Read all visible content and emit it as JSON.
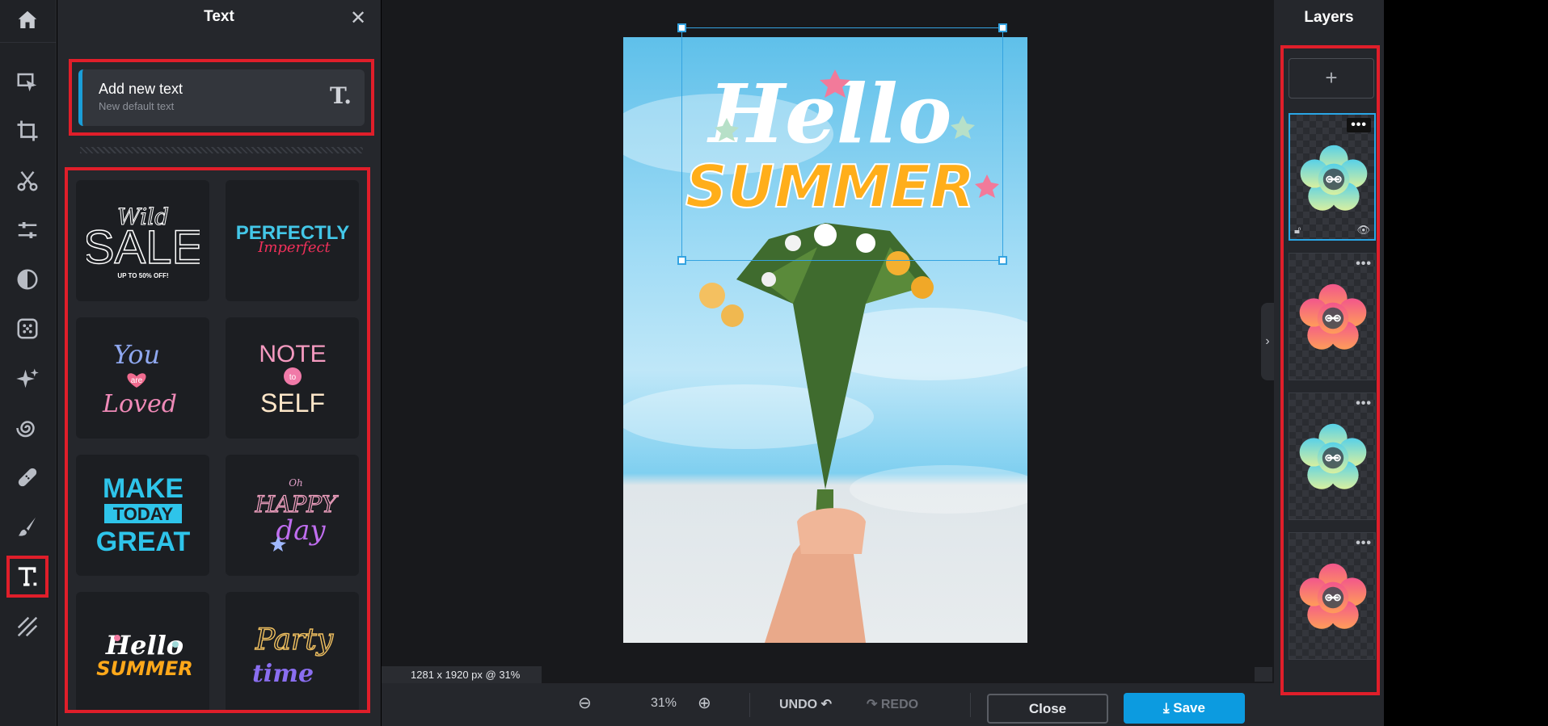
{
  "toolbar": {
    "tools": [
      "home-icon",
      "select-arrow-icon",
      "crop-icon",
      "scissors-icon",
      "adjust-sliders-icon",
      "contrast-icon",
      "effects-icon",
      "sparkle-icon",
      "swirl-icon",
      "bandage-icon",
      "brush-icon",
      "text-icon",
      "texture-icon"
    ],
    "active_tool": "text-icon"
  },
  "text_panel": {
    "title": "Text",
    "add_new_title": "Add new text",
    "add_new_subtitle": "New default text",
    "templates": [
      "Wild SALE",
      "PERFECTLY Imperfect",
      "You are Loved",
      "NOTE to SELF",
      "MAKE TODAY GREAT",
      "Oh HAPPY day",
      "Hello SUMMER",
      "Party time"
    ],
    "template_subtext": {
      "wild_sale_word": "Wild",
      "sale_word": "SALE",
      "sale_note": "UP TO 50% OFF!",
      "perfectly_word": "PERFECTLY",
      "imperfect_word": "Imperfect",
      "you_word": "You",
      "are_word": "are",
      "loved_word": "Loved",
      "note_word": "NOTE",
      "to_word": "to",
      "self_word": "SELF",
      "make_word": "MAKE",
      "today_word": "TODAY",
      "great_word": "GREAT",
      "oh_word": "Oh",
      "happy_word": "HAPPY",
      "day_word": "day",
      "hello_word": "Hello",
      "summer_word": "SUMMER",
      "party_word": "Party",
      "time_word": "time"
    }
  },
  "canvas": {
    "size_info": "1281 x 1920 px @ 31%",
    "overlay_hello": "Hello",
    "overlay_summer": "SUMMER"
  },
  "bottom_bar": {
    "zoom": "31%",
    "undo_label": "UNDO",
    "redo_label": "REDO",
    "close_label": "Close",
    "save_label": "Save"
  },
  "layers_panel": {
    "title": "Layers",
    "add_label": "+",
    "layers": [
      {
        "colors": [
          "#57d0e8",
          "#d8f0a0"
        ],
        "selected": true
      },
      {
        "colors": [
          "#f2568c",
          "#ff9c5a"
        ],
        "selected": false
      },
      {
        "colors": [
          "#57d0e8",
          "#d8f0a0"
        ],
        "selected": false
      },
      {
        "colors": [
          "#f2568c",
          "#ff9c5a"
        ],
        "selected": false
      }
    ],
    "menu_glyph": "•••"
  },
  "colors": {
    "accent": "#0c9be0",
    "highlight": "#e01e2a",
    "panel_bg": "#25272c"
  }
}
